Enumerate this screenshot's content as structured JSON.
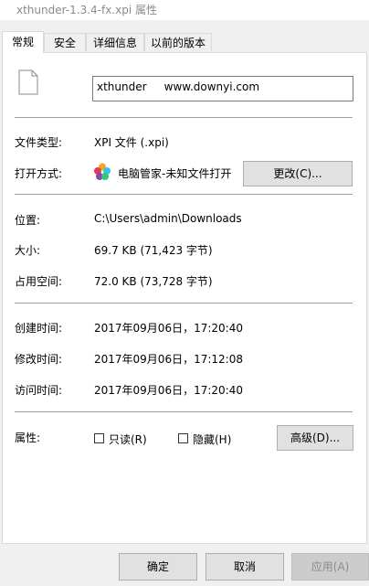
{
  "window": {
    "title": "xthunder-1.3.4-fx.xpi 属性"
  },
  "tabs": [
    {
      "label": "常规",
      "active": true
    },
    {
      "label": "安全",
      "active": false
    },
    {
      "label": "详细信息",
      "active": false
    },
    {
      "label": "以前的版本",
      "active": false
    }
  ],
  "file": {
    "icon": "file-icon",
    "name_value": "xthunder     www.downyi.com"
  },
  "general": {
    "type_label": "文件类型:",
    "type_value": "XPI 文件 (.xpi)",
    "open_label": "打开方式:",
    "open_value": "电脑管家-未知文件打开",
    "open_icon": "app-icon",
    "change_button": "更改(C)..."
  },
  "location": {
    "location_label": "位置:",
    "location_value": "C:\\Users\\admin\\Downloads",
    "size_label": "大小:",
    "size_value": "69.7 KB (71,423 字节)",
    "disk_label": "占用空间:",
    "disk_value": "72.0 KB (73,728 字节)"
  },
  "times": {
    "created_label": "创建时间:",
    "created_value": "2017年09月06日，17:20:40",
    "modified_label": "修改时间:",
    "modified_value": "2017年09月06日，17:12:08",
    "accessed_label": "访问时间:",
    "accessed_value": "2017年09月06日，17:20:40"
  },
  "attributes": {
    "label": "属性:",
    "readonly_label": "只读(R)",
    "readonly_checked": false,
    "hidden_label": "隐藏(H)",
    "hidden_checked": false,
    "advanced_button": "高级(D)..."
  },
  "footer": {
    "ok": "确定",
    "cancel": "取消",
    "apply": "应用(A)"
  },
  "colors": {
    "panel_bg": "#ffffff",
    "window_bg": "#f0f0f0",
    "button_bg": "#e1e1e1",
    "separator": "#a0a0a0"
  }
}
